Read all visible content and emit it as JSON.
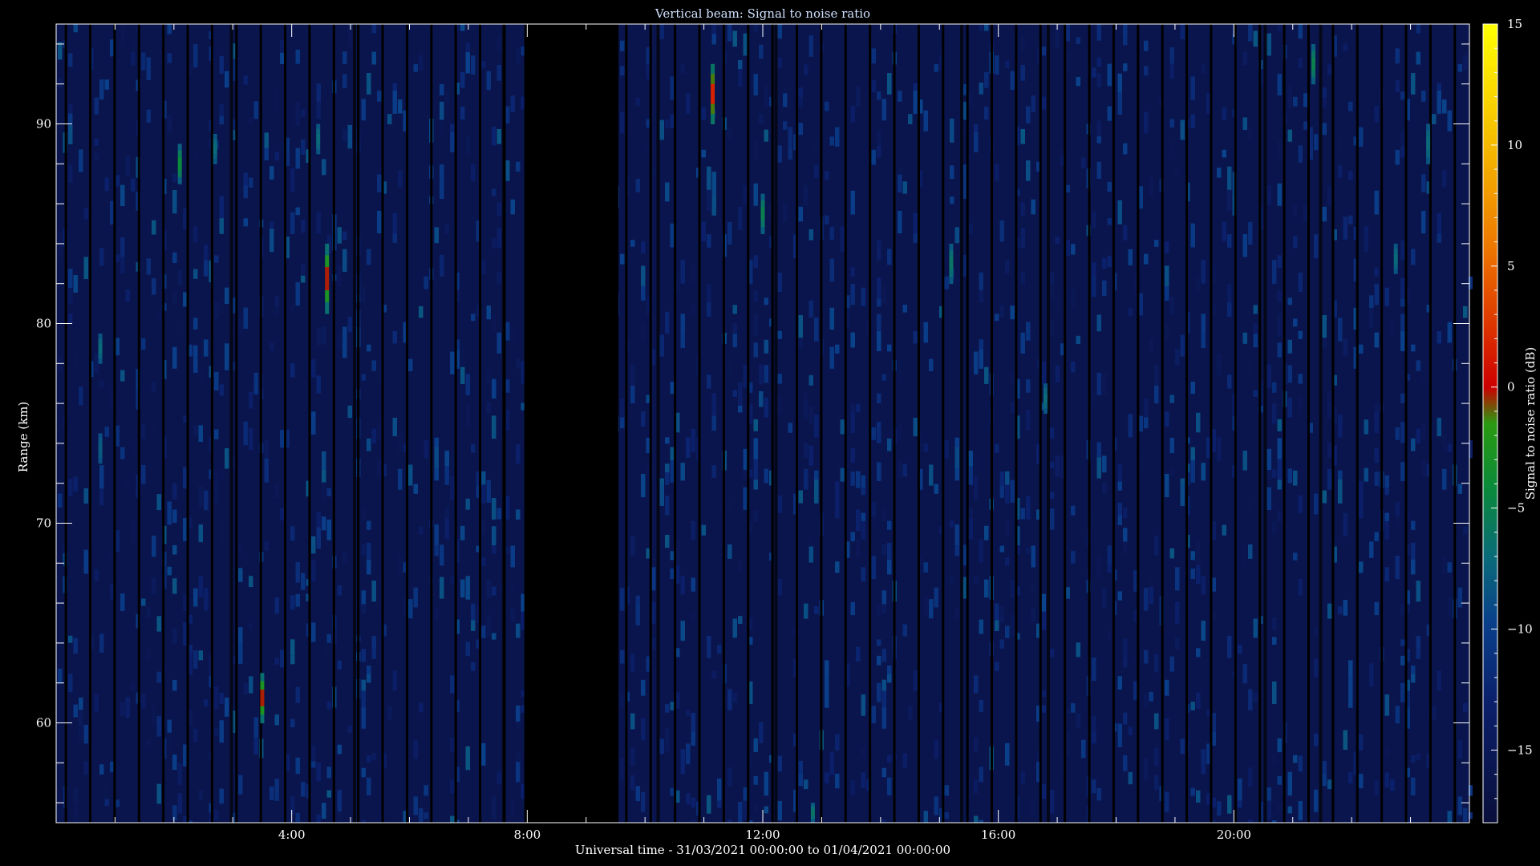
{
  "chart_data": {
    "type": "heatmap",
    "title": "Vertical beam: Signal to noise ratio",
    "xlabel": "Universal time - 31/03/2021 00:00:00 to 01/04/2021 00:00:00",
    "ylabel": "Range (km)",
    "colorbar_label": "Signal to noise ratio (dB)",
    "x_unit": "hours UT",
    "xlim": [
      0,
      24
    ],
    "ylim": [
      55,
      95
    ],
    "clim": [
      -18,
      15
    ],
    "xticks": [
      {
        "value": 4,
        "label": "4:00"
      },
      {
        "value": 8,
        "label": "8:00"
      },
      {
        "value": 12,
        "label": "12:00"
      },
      {
        "value": 16,
        "label": "16:00"
      },
      {
        "value": 20,
        "label": "20:00"
      }
    ],
    "yticks": [
      {
        "value": 60,
        "label": "60"
      },
      {
        "value": 70,
        "label": "70"
      },
      {
        "value": 80,
        "label": "80"
      },
      {
        "value": 90,
        "label": "90"
      }
    ],
    "cbar_ticks": [
      {
        "value": -15,
        "label": "−15"
      },
      {
        "value": -10,
        "label": "−10"
      },
      {
        "value": -5,
        "label": "−5"
      },
      {
        "value": 0,
        "label": "0"
      },
      {
        "value": 5,
        "label": "5"
      },
      {
        "value": 10,
        "label": "10"
      },
      {
        "value": 15,
        "label": "15"
      }
    ],
    "background_snr_db": -16,
    "data_gap": {
      "start": 7.95,
      "end": 9.55
    },
    "echoes": [
      {
        "time": 0.75,
        "range_start": 78.0,
        "range_end": 79.5,
        "snr_max": -7
      },
      {
        "time": 0.75,
        "range_start": 73.0,
        "range_end": 74.5,
        "snr_max": -8
      },
      {
        "time": 2.1,
        "range_start": 87.0,
        "range_end": 89.0,
        "snr_max": -4
      },
      {
        "time": 2.7,
        "range_start": 88.0,
        "range_end": 89.5,
        "snr_max": -7
      },
      {
        "time": 3.5,
        "range_start": 60.0,
        "range_end": 62.5,
        "snr_max": 0
      },
      {
        "time": 4.6,
        "range_start": 80.5,
        "range_end": 84.0,
        "snr_max": 0
      },
      {
        "time": 4.45,
        "range_start": 88.5,
        "range_end": 90.0,
        "snr_max": -7
      },
      {
        "time": 11.15,
        "range_start": 90.0,
        "range_end": 93.0,
        "snr_max": 2
      },
      {
        "time": 12.0,
        "range_start": 84.5,
        "range_end": 86.5,
        "snr_max": -5
      },
      {
        "time": 12.85,
        "range_start": 55.0,
        "range_end": 56.0,
        "snr_max": -6
      },
      {
        "time": 15.2,
        "range_start": 82.0,
        "range_end": 84.0,
        "snr_max": -6
      },
      {
        "time": 16.8,
        "range_start": 75.5,
        "range_end": 77.0,
        "snr_max": -7
      },
      {
        "time": 21.35,
        "range_start": 92.0,
        "range_end": 94.0,
        "snr_max": -5
      },
      {
        "time": 22.75,
        "range_start": 82.5,
        "range_end": 84.0,
        "snr_max": -7
      },
      {
        "time": 23.3,
        "range_start": 88.0,
        "range_end": 90.0,
        "snr_max": -7
      }
    ]
  }
}
